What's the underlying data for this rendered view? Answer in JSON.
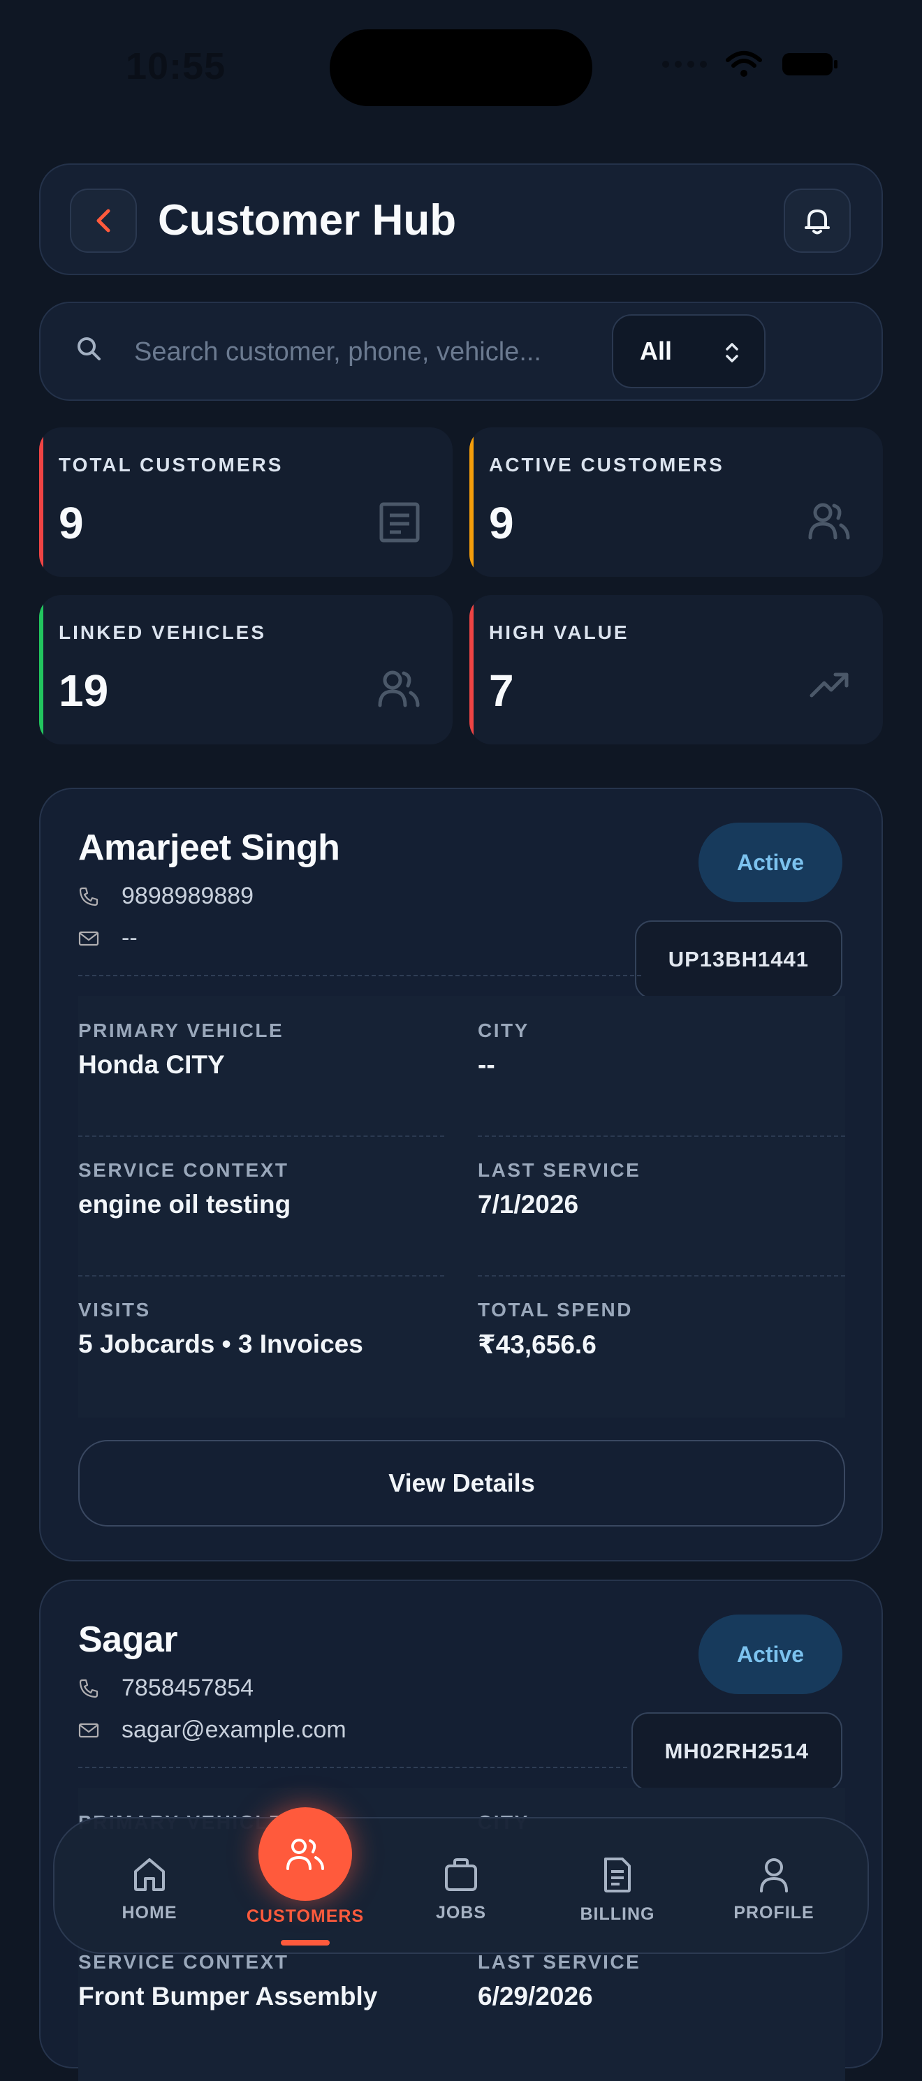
{
  "status_bar": {
    "time": "10:55"
  },
  "header": {
    "title": "Customer Hub"
  },
  "search": {
    "placeholder": "Search customer, phone, vehicle...",
    "filter_value": "All"
  },
  "stats": [
    {
      "label": "TOTAL CUSTOMERS",
      "value": "9",
      "accent": "#ef4444",
      "icon": "list-icon"
    },
    {
      "label": "ACTIVE CUSTOMERS",
      "value": "9",
      "accent": "#f59e0b",
      "icon": "users-icon"
    },
    {
      "label": "LINKED VEHICLES",
      "value": "19",
      "accent": "#22c55e",
      "icon": "users-icon"
    },
    {
      "label": "HIGH VALUE",
      "value": "7",
      "accent": "#ef4444",
      "icon": "trending-up-icon"
    }
  ],
  "customers": [
    {
      "name": "Amarjeet Singh",
      "phone": "9898989889",
      "email": "--",
      "status": "Active",
      "plate": "UP13BH1441",
      "primary_vehicle_label": "PRIMARY VEHICLE",
      "primary_vehicle": "Honda CITY",
      "city_label": "CITY",
      "city": "--",
      "service_context_label": "SERVICE CONTEXT",
      "service_context": "engine oil testing",
      "last_service_label": "LAST SERVICE",
      "last_service": "7/1/2026",
      "visits_label": "VISITS",
      "visits": "5 Jobcards • 3 Invoices",
      "total_spend_label": "TOTAL SPEND",
      "total_spend": "₹43,656.6",
      "view_label": "View Details"
    },
    {
      "name": "Sagar",
      "phone": "7858457854",
      "email": "sagar@example.com",
      "status": "Active",
      "plate": "MH02RH2514",
      "primary_vehicle_label": "PRIMARY VEHICLE",
      "city_label": "CITY",
      "service_context_label": "SERVICE CONTEXT",
      "service_context": "Front Bumper Assembly",
      "last_service_label": "LAST SERVICE",
      "last_service": "6/29/2026"
    }
  ],
  "nav": {
    "home": "HOME",
    "customers": "CUSTOMERS",
    "jobs": "JOBS",
    "billing": "BILLING",
    "profile": "PROFILE",
    "active": "customers"
  },
  "colors": {
    "accent": "#ff5a3c",
    "badge_bg": "#173a5c",
    "badge_text": "#7cc2ee",
    "background": "#0f1724"
  }
}
